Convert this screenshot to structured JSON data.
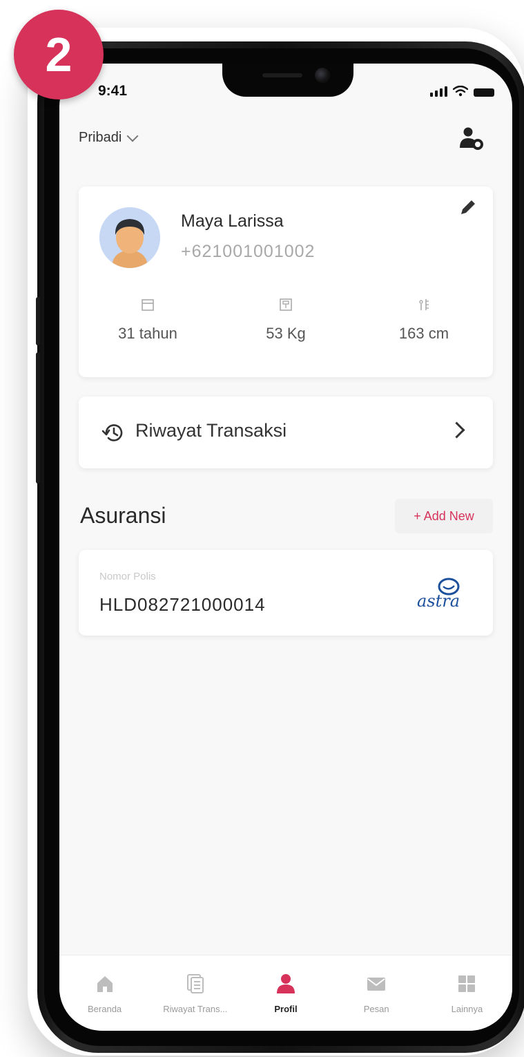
{
  "step_badge": "2",
  "status_bar": {
    "time": "9:41"
  },
  "header": {
    "account_type": "Pribadi"
  },
  "profile": {
    "name": "Maya Larissa",
    "phone": "+621001001002",
    "stats": [
      {
        "icon": "calendar-icon",
        "value": "31 tahun"
      },
      {
        "icon": "weight-scale-icon",
        "value": "53 Kg"
      },
      {
        "icon": "height-ruler-icon",
        "value": "163 cm"
      }
    ]
  },
  "history": {
    "label": "Riwayat Transaksi"
  },
  "insurance": {
    "title": "Asuransi",
    "add_new_label": "+ Add New",
    "policy": {
      "label": "Nomor Polis",
      "number": "HLD082721000014",
      "insurer": "astra"
    }
  },
  "bottom_nav": {
    "items": [
      {
        "label": "Beranda",
        "icon": "home-icon",
        "active": false
      },
      {
        "label": "Riwayat Trans...",
        "icon": "document-icon",
        "active": false
      },
      {
        "label": "Profil",
        "icon": "user-icon",
        "active": true
      },
      {
        "label": "Pesan",
        "icon": "mail-icon",
        "active": false
      },
      {
        "label": "Lainnya",
        "icon": "grid-icon",
        "active": false
      }
    ]
  },
  "colors": {
    "accent": "#d6325a",
    "background": "#f8f8f9",
    "card": "#ffffff"
  }
}
